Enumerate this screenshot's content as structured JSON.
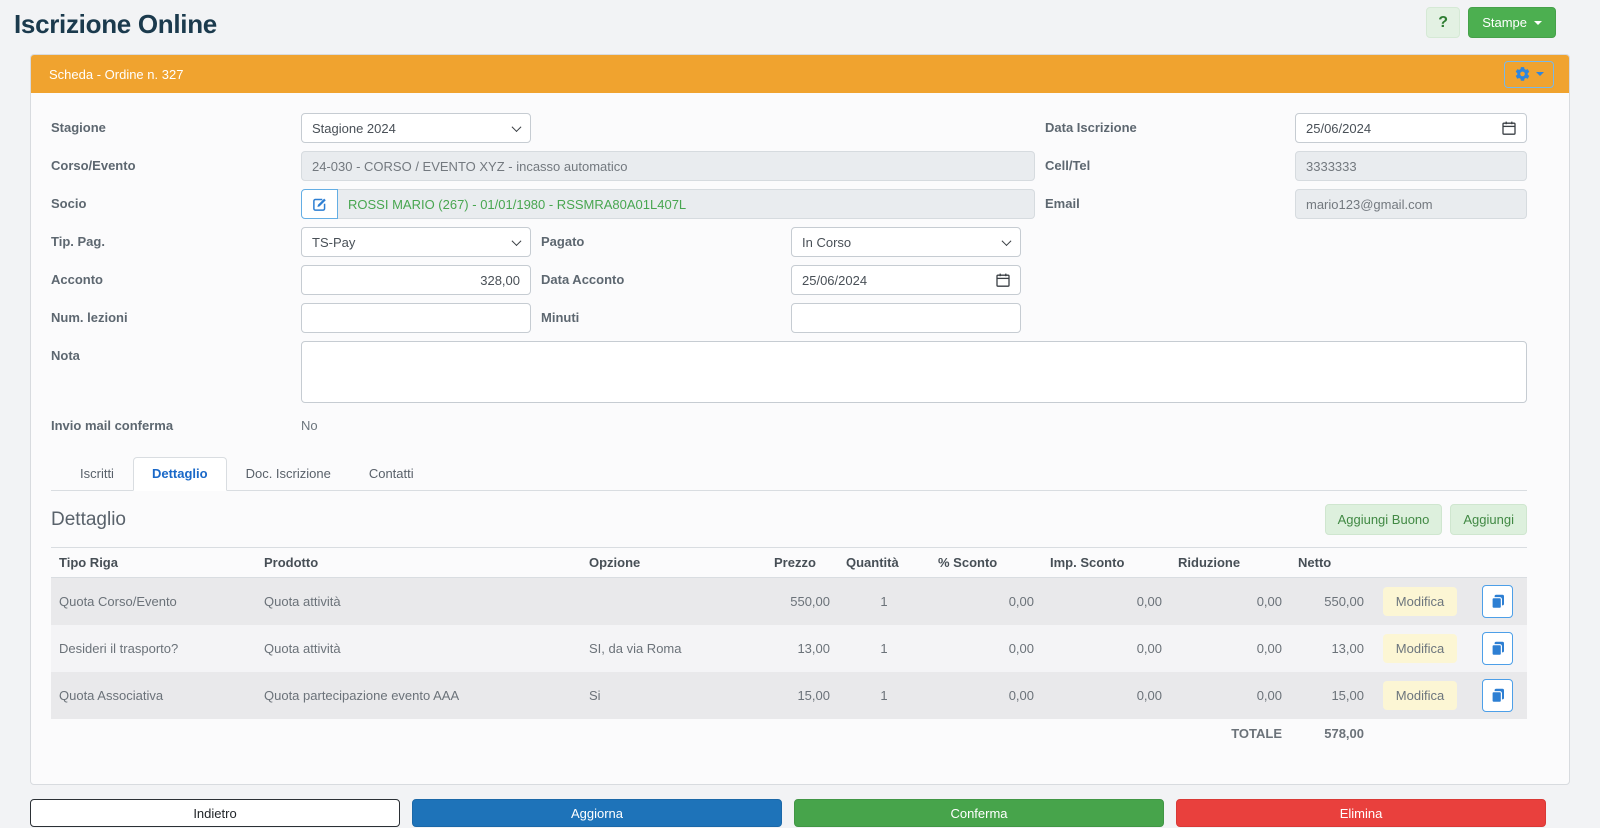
{
  "page": {
    "title": "Iscrizione Online",
    "help_label": "?",
    "stampe_label": "Stampe"
  },
  "panel": {
    "title": "Scheda - Ordine n. 327"
  },
  "form": {
    "labels": {
      "stagione": "Stagione",
      "corso_evento": "Corso/Evento",
      "socio": "Socio",
      "tip_pag": "Tip. Pag.",
      "pagato": "Pagato",
      "acconto": "Acconto",
      "data_acconto": "Data Acconto",
      "num_lezioni": "Num. lezioni",
      "minuti": "Minuti",
      "nota": "Nota",
      "invio_mail": "Invio mail conferma",
      "data_iscrizione": "Data Iscrizione",
      "cell_tel": "Cell/Tel",
      "email": "Email"
    },
    "values": {
      "stagione": "Stagione 2024",
      "corso_evento": "24-030 - CORSO / EVENTO XYZ - incasso automatico",
      "socio": "ROSSI MARIO (267) - 01/01/1980 - RSSMRA80A01L407L",
      "tip_pag": "TS-Pay",
      "pagato": "In Corso",
      "acconto": "328,00",
      "data_acconto": "25/06/2024",
      "num_lezioni": "",
      "minuti": "",
      "nota": "",
      "invio_mail": "No",
      "data_iscrizione": "25/06/2024",
      "cell_tel": "3333333",
      "email": "mario123@gmail.com"
    }
  },
  "tabs": {
    "iscritti": "Iscritti",
    "dettaglio": "Dettaglio",
    "doc_iscrizione": "Doc. Iscrizione",
    "contatti": "Contatti"
  },
  "dettaglio": {
    "heading": "Dettaglio",
    "aggiungi_buono_label": "Aggiungi Buono",
    "aggiungi_label": "Aggiungi",
    "modifica_label": "Modifica",
    "headers": {
      "tipo_riga": "Tipo Riga",
      "prodotto": "Prodotto",
      "opzione": "Opzione",
      "prezzo": "Prezzo",
      "quantita": "Quantità",
      "sconto_pct": "% Sconto",
      "imp_sconto": "Imp. Sconto",
      "riduzione": "Riduzione",
      "netto": "Netto"
    },
    "rows": [
      {
        "tipo_riga": "Quota Corso/Evento",
        "prodotto": "Quota attività",
        "opzione": "",
        "prezzo": "550,00",
        "quantita": "1",
        "sconto_pct": "0,00",
        "imp_sconto": "0,00",
        "riduzione": "0,00",
        "netto": "550,00"
      },
      {
        "tipo_riga": "Desideri il trasporto?",
        "prodotto": "Quota attività",
        "opzione": "SI, da via Roma",
        "prezzo": "13,00",
        "quantita": "1",
        "sconto_pct": "0,00",
        "imp_sconto": "0,00",
        "riduzione": "0,00",
        "netto": "13,00"
      },
      {
        "tipo_riga": "Quota Associativa",
        "prodotto": "Quota partecipazione evento AAA",
        "opzione": "Si",
        "prezzo": "15,00",
        "quantita": "1",
        "sconto_pct": "0,00",
        "imp_sconto": "0,00",
        "riduzione": "0,00",
        "netto": "15,00"
      }
    ],
    "totale_label": "TOTALE",
    "totale_value": "578,00"
  },
  "footer": {
    "indietro": "Indietro",
    "aggiorna": "Aggiorna",
    "conferma": "Conferma",
    "elimina": "Elimina"
  },
  "colors": {
    "panel_header_orange": "#F0A32F",
    "primary_blue": "#1E73B9",
    "success_green": "#47A44B",
    "danger_red": "#E9403D",
    "active_tab_blue": "#1968C8",
    "socio_text_green": "#48A650",
    "modifica_yellow": "#FCF6D4"
  },
  "icons": {
    "help-icon": "?",
    "caret-down-icon": "css-triangle-down",
    "gear-icon": "svg-gear",
    "chevron-down-icon": "css-chevron",
    "calendar-icon": "svg-calendar",
    "edit-icon": "svg-pencil-square",
    "copy-icon": "svg-copy-pages"
  }
}
